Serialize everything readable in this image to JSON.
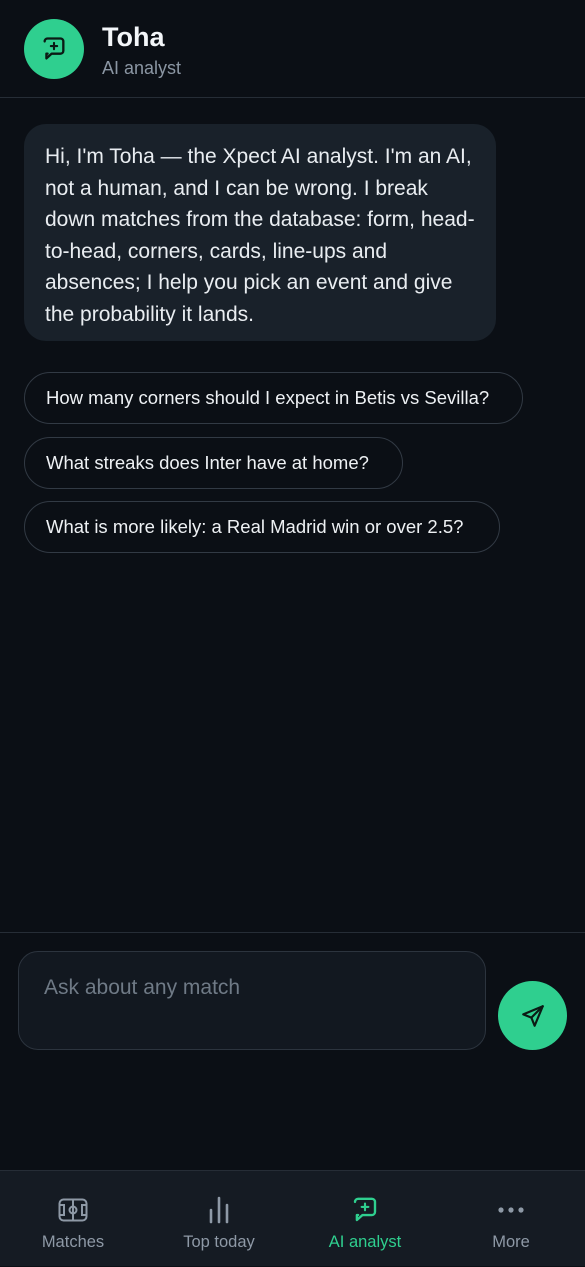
{
  "header": {
    "title": "Toha",
    "subtitle": "AI analyst"
  },
  "chat": {
    "intro_message": "Hi, I'm Toha — the Xpect AI analyst. I'm an AI, not a human, and I can be wrong. I break down matches from the database: form, head-to-head, corners, cards, line-ups and absences; I help you pick an event and give the probability it lands.",
    "suggestions": [
      "How many corners should I expect in Betis vs Sevilla?",
      "What streaks does Inter have at home?",
      "What is more likely: a Real Madrid win or over 2.5?"
    ]
  },
  "composer": {
    "placeholder": "Ask about any match",
    "send_icon": "send-icon"
  },
  "nav": {
    "items": [
      {
        "label": "Matches",
        "icon": "pitch-icon",
        "active": false
      },
      {
        "label": "Top today",
        "icon": "bars-icon",
        "active": false
      },
      {
        "label": "AI analyst",
        "icon": "ai-chat-icon",
        "active": true
      },
      {
        "label": "More",
        "icon": "more-icon",
        "active": false
      }
    ]
  },
  "colors": {
    "accent": "#2fcf8f",
    "background": "#0b0f15",
    "bubble": "#19212a",
    "nav_background": "#151b23"
  }
}
